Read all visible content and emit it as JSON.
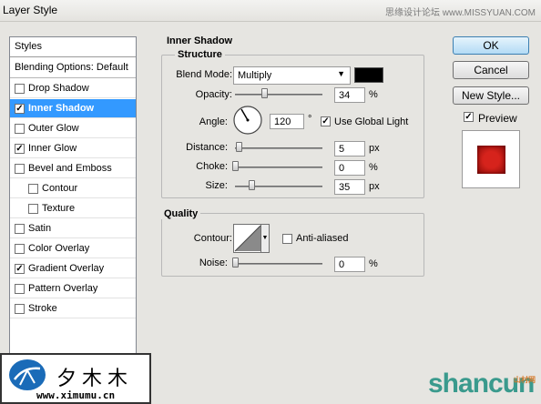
{
  "window": {
    "title": "Layer Style",
    "watermark_top": "思缘设计论坛 www.MISSYUAN.COM"
  },
  "styles_list": {
    "header": "Styles",
    "blending_options": "Blending Options: Default",
    "items": [
      {
        "label": "Drop Shadow",
        "checked": false,
        "indent": false,
        "selected": false
      },
      {
        "label": "Inner Shadow",
        "checked": true,
        "indent": false,
        "selected": true
      },
      {
        "label": "Outer Glow",
        "checked": false,
        "indent": false,
        "selected": false
      },
      {
        "label": "Inner Glow",
        "checked": true,
        "indent": false,
        "selected": false
      },
      {
        "label": "Bevel and Emboss",
        "checked": false,
        "indent": false,
        "selected": false
      },
      {
        "label": "Contour",
        "checked": false,
        "indent": true,
        "selected": false
      },
      {
        "label": "Texture",
        "checked": false,
        "indent": true,
        "selected": false
      },
      {
        "label": "Satin",
        "checked": false,
        "indent": false,
        "selected": false
      },
      {
        "label": "Color Overlay",
        "checked": false,
        "indent": false,
        "selected": false
      },
      {
        "label": "Gradient Overlay",
        "checked": true,
        "indent": false,
        "selected": false
      },
      {
        "label": "Pattern Overlay",
        "checked": false,
        "indent": false,
        "selected": false
      },
      {
        "label": "Stroke",
        "checked": false,
        "indent": false,
        "selected": false
      }
    ]
  },
  "inner_shadow": {
    "title": "Inner Shadow",
    "structure": {
      "title": "Structure",
      "blend_mode_label": "Blend Mode:",
      "blend_mode_value": "Multiply",
      "shadow_color": "#000000",
      "opacity_label": "Opacity:",
      "opacity_value": "34",
      "opacity_unit": "%",
      "angle_label": "Angle:",
      "angle_value": "120",
      "angle_unit": "°",
      "use_global_light_label": "Use Global Light",
      "use_global_light": true,
      "distance_label": "Distance:",
      "distance_value": "5",
      "distance_unit": "px",
      "choke_label": "Choke:",
      "choke_value": "0",
      "choke_unit": "%",
      "size_label": "Size:",
      "size_value": "35",
      "size_unit": "px"
    },
    "quality": {
      "title": "Quality",
      "contour_label": "Contour:",
      "anti_aliased_label": "Anti-aliased",
      "anti_aliased": false,
      "noise_label": "Noise:",
      "noise_value": "0",
      "noise_unit": "%"
    }
  },
  "buttons": {
    "ok": "OK",
    "cancel": "Cancel",
    "new_style": "New Style...",
    "preview_label": "Preview",
    "preview_checked": true
  },
  "watermarks": {
    "logo_text": "夕木木",
    "logo_url": "www.ximumu.cn",
    "brand": "shancun",
    "brand_sub": "山村网"
  }
}
